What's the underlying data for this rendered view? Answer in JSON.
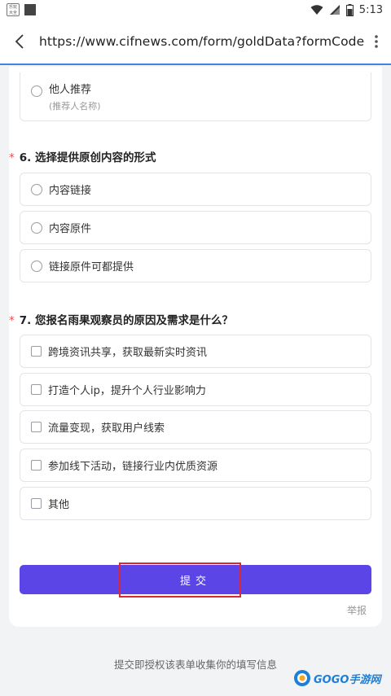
{
  "status_bar": {
    "app_badge": "乐玩\n大全",
    "time": "5:13"
  },
  "browser": {
    "url": "https://www.cifnews.com/form/goldData?formCode=CYZ..."
  },
  "form": {
    "partial_option": {
      "label": "他人推荐",
      "hint": "(推荐人名称)"
    },
    "question6": {
      "required_mark": "*",
      "title": "6. 选择提供原创内容的形式",
      "options": [
        "内容链接",
        "内容原件",
        "链接原件可都提供"
      ]
    },
    "question7": {
      "required_mark": "*",
      "title": "7. 您报名雨果观察员的原因及需求是什么？",
      "options": [
        "跨境资讯共享，获取最新实时资讯",
        "打造个人ip，提升个人行业影响力",
        "流量变现，获取用户线索",
        "参加线下活动，链接行业内优质资源",
        "其他"
      ]
    },
    "submit_label": "提交",
    "report_label": "举报"
  },
  "footer": {
    "note": "提交即授权该表单收集你的填写信息"
  },
  "watermark": {
    "text": "GOGO手游网"
  },
  "colors": {
    "accent": "#5b45e6",
    "required": "#e5484d",
    "url_underline": "#3f82e4"
  }
}
